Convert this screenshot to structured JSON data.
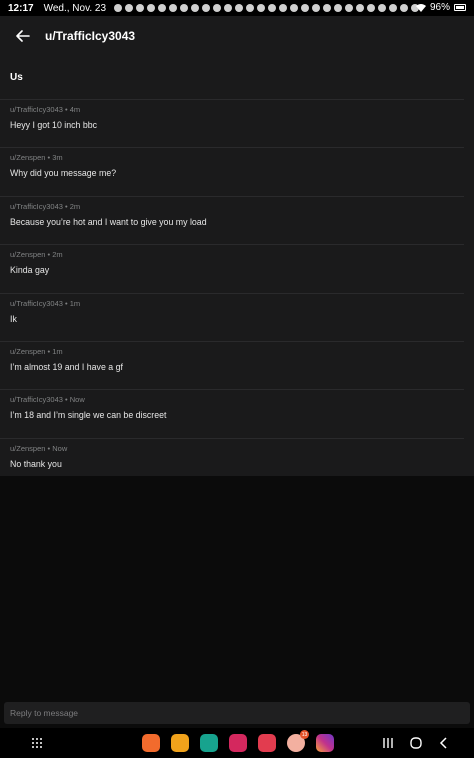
{
  "status_bar": {
    "time": "12:17",
    "date": "Wed., Nov. 23",
    "battery": "96%"
  },
  "header": {
    "title": "u/TrafficIcy3043",
    "back_icon": "arrow-left-icon"
  },
  "thread": {
    "subject": "Us",
    "messages": [
      {
        "meta": "u/TrafficIcy3043 • 4m",
        "body": "Heyy I got 10 inch bbc"
      },
      {
        "meta": "u/Zenspen • 3m",
        "body": "Why did you message me?"
      },
      {
        "meta": "u/TrafficIcy3043 • 2m",
        "body": "Because you’re hot and I want to give you my load"
      },
      {
        "meta": "u/Zenspen • 2m",
        "body": "Kinda gay"
      },
      {
        "meta": "u/TrafficIcy3043 • 1m",
        "body": "Ik"
      },
      {
        "meta": "u/Zenspen • 1m",
        "body": "I’m almost 19 and I have a gf"
      },
      {
        "meta": "u/TrafficIcy3043 • Now",
        "body": "I’m 18 and I’m single we can be discreet"
      },
      {
        "meta": "u/Zenspen • Now",
        "body": "No thank you"
      }
    ]
  },
  "reply": {
    "placeholder": "Reply to message"
  },
  "nav": {
    "apps_icon": "app-grid-icon",
    "dock": [
      {
        "name": "app-1-icon",
        "color": "#f26b2d"
      },
      {
        "name": "app-2-icon",
        "color": "#f0a21b"
      },
      {
        "name": "calendar-icon",
        "color": "#17a38e"
      },
      {
        "name": "flower-app-icon",
        "color": "#d4285e"
      },
      {
        "name": "video-app-icon",
        "color": "#e23c4f"
      },
      {
        "name": "avatar-app-icon",
        "color": "#f3b0a0",
        "badge": "13"
      },
      {
        "name": "instagram-icon",
        "color": "#c1328c"
      }
    ]
  }
}
